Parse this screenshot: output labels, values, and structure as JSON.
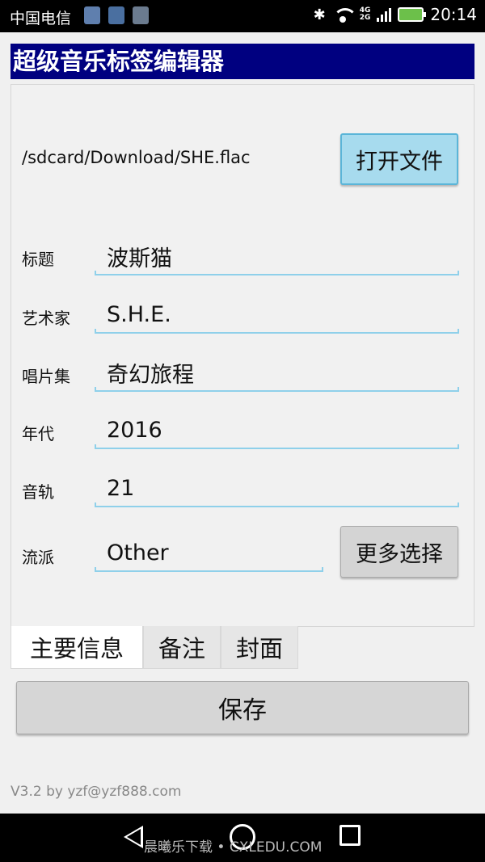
{
  "status_bar": {
    "carrier": "中国电信",
    "network": "4G",
    "network2": "2G",
    "time": "20:14"
  },
  "app": {
    "title": "超级音乐标签编辑器",
    "file_path": "/sdcard/Download/SHE.flac",
    "open_button": "打开文件",
    "fields": {
      "title_label": "标题",
      "title_value": "波斯猫",
      "artist_label": "艺术家",
      "artist_value": "S.H.E.",
      "album_label": "唱片集",
      "album_value": "奇幻旅程",
      "year_label": "年代",
      "year_value": "2016",
      "track_label": "音轨",
      "track_value": "21",
      "genre_label": "流派",
      "genre_value": "Other"
    },
    "more_button": "更多选择",
    "tabs": [
      "主要信息",
      "备注",
      "封面"
    ],
    "save_button": "保存",
    "version": "V3.2 by  yzf@yzf888.com"
  },
  "navbar": {
    "watermark": "晨曦乐下载 • CXLEDU.COM"
  },
  "colors": {
    "title_bg": "#000080",
    "open_button_bg": "#a7dbee",
    "underline": "#8fd0ea"
  }
}
